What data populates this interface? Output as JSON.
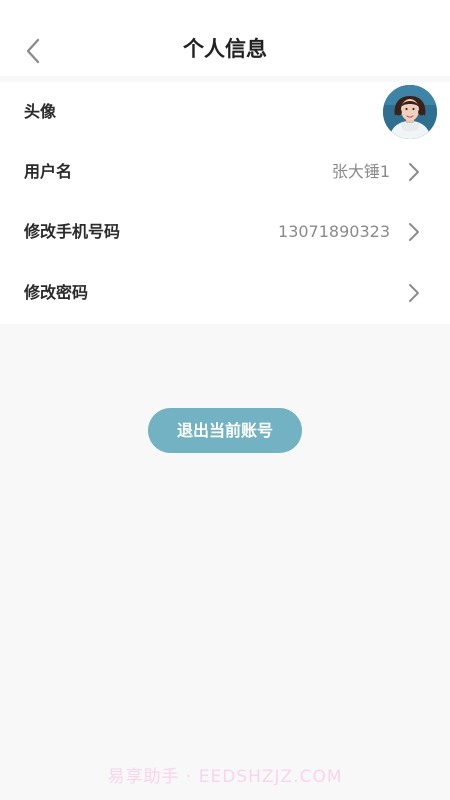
{
  "header": {
    "title": "个人信息",
    "back_icon": "chevron-left-icon"
  },
  "profile": {
    "avatar_label": "头像",
    "username_label": "用户名",
    "username_value": "张大锤1",
    "phone_label": "修改手机号码",
    "phone_value": "13071890323",
    "password_label": "修改密码",
    "row_icon": "chevron-right-icon"
  },
  "actions": {
    "logout_label": "退出当前账号"
  },
  "watermark": {
    "text": "易享助手 · EEDSHZJZ.COM"
  },
  "colors": {
    "accent": "#72b2c2",
    "page_background": "#f8f8f9",
    "surface": "#ffffff",
    "label_text": "#2b2b2b",
    "value_text": "#8a8a8a",
    "watermark": "#f7d5ea"
  }
}
